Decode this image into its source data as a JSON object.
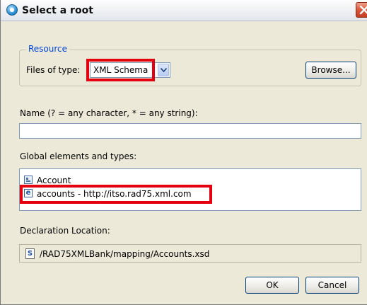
{
  "window": {
    "title": "Select a root",
    "close_icon": "close-icon",
    "app_icon": "eclipse-dialog-icon"
  },
  "resource": {
    "group_label": "Resource",
    "files_of_type_label": "Files of type:",
    "files_of_type_value": "XML Schema",
    "browse_label": "Browse..."
  },
  "name_filter": {
    "label": "Name (? = any character, * = any string):",
    "value": ""
  },
  "global_elements": {
    "label": "Global elements and types:",
    "items": [
      {
        "label": "Account",
        "icon": "complex-type-icon"
      },
      {
        "label": "accounts - http://itso.rad75.xml.com",
        "icon": "element-icon",
        "icon_letter": "e"
      }
    ]
  },
  "declaration": {
    "label": "Declaration Location:",
    "path": "/RAD75XMLBank/mapping/Accounts.xsd",
    "icon": "schema-file-icon",
    "icon_letter": "S"
  },
  "buttons": {
    "ok_label": "OK",
    "cancel_label": "Cancel"
  },
  "colors": {
    "highlight": "#e4000f",
    "group_title": "#0046d5",
    "dialog_background": "#ece9d8"
  }
}
